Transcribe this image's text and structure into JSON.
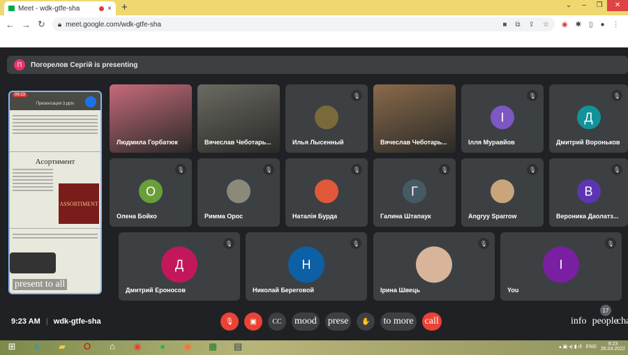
{
  "browser": {
    "tab_title": "Meet - wdk-gtfe-sha",
    "url": "meet.google.com/wdk-gtfe-sha"
  },
  "banner": {
    "avatar_letter": "П",
    "text": "Погорелов Сергій is presenting"
  },
  "presentation": {
    "time": "09:23",
    "title": "Презентация 3.pptx",
    "slide_heading": "Асортимент",
    "product": "ASSORTIMENT",
    "present_label": "present to all"
  },
  "participants": [
    {
      "name": "Людмила Горбатюк",
      "type": "video",
      "color": "#c76a7a"
    },
    {
      "name": "Вячеслав Чеботарь...",
      "type": "video",
      "color": "#6b6a62"
    },
    {
      "name": "Илья Лысенный",
      "type": "photo",
      "color": "#7a6a3a"
    },
    {
      "name": "Вячеслав Чеботарь...",
      "type": "video",
      "color": "#8a6a4a"
    },
    {
      "name": "Ілля Муравйов",
      "type": "letter",
      "letter": "І",
      "color": "#7e57c2"
    },
    {
      "name": "Дмитрий Вороньков",
      "type": "letter",
      "letter": "Д",
      "color": "#12939a"
    },
    {
      "name": "Олена Бойко",
      "type": "letter",
      "letter": "О",
      "color": "#689f38"
    },
    {
      "name": "Римма Орос",
      "type": "photo",
      "color": "#8a8a7a"
    },
    {
      "name": "Наталія Бурда",
      "type": "photo",
      "color": "#e0583a"
    },
    {
      "name": "Галина Штапаук",
      "type": "letter",
      "letter": "Г",
      "color": "#455a64"
    },
    {
      "name": "Angryy Sparrow",
      "type": "photo",
      "color": "#c9a57a"
    },
    {
      "name": "Вероника Даолатз...",
      "type": "letter",
      "letter": "В",
      "color": "#5e35b1"
    },
    {
      "name": "Дмитрий Ероносов",
      "type": "letter",
      "letter": "Д",
      "color": "#c2185b"
    },
    {
      "name": "Николай Береговой",
      "type": "letter",
      "letter": "Н",
      "color": "#0d5fa6"
    },
    {
      "name": "Ірина Швець",
      "type": "photo",
      "color": "#d8b59a"
    },
    {
      "name": "You",
      "type": "letter",
      "letter": "І",
      "color": "#7b1fa2"
    }
  ],
  "footer": {
    "time": "9:23 AM",
    "separator": "|",
    "code": "wdk-gtfe-sha",
    "captions": "CC",
    "mood": "mood",
    "present": "prese",
    "raise": "✋",
    "to": "to",
    "more": "more",
    "call": "call",
    "info": "info",
    "people": "people",
    "chat": "cha",
    "people_count": "17"
  },
  "taskbar": {
    "lang": "ENG",
    "time": "9:23",
    "date": "26.04.2022"
  }
}
